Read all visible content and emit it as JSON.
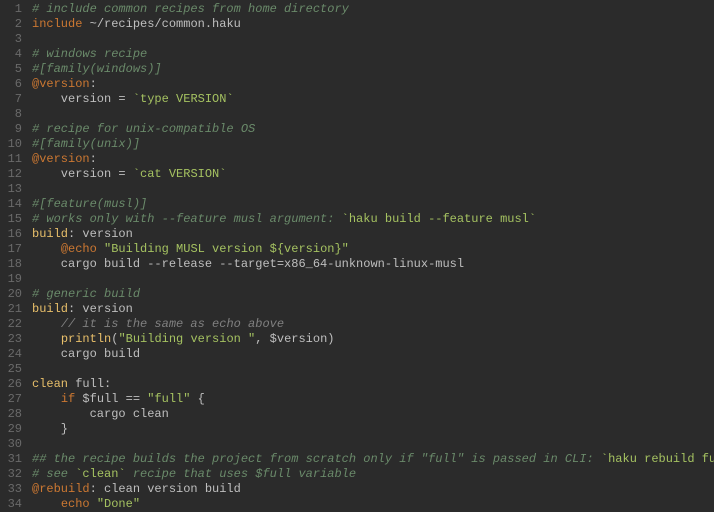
{
  "lines": [
    {
      "n": 1,
      "segs": [
        {
          "cls": "comment",
          "t": "# include common recipes from home directory"
        }
      ]
    },
    {
      "n": 2,
      "segs": [
        {
          "cls": "keyword",
          "t": "include"
        },
        {
          "cls": "plain",
          "t": " ~/recipes/common.haku"
        }
      ]
    },
    {
      "n": 3,
      "segs": []
    },
    {
      "n": 4,
      "segs": [
        {
          "cls": "comment",
          "t": "# windows recipe"
        }
      ]
    },
    {
      "n": 5,
      "segs": [
        {
          "cls": "comment",
          "t": "#[family(windows)]"
        }
      ]
    },
    {
      "n": 6,
      "segs": [
        {
          "cls": "keyword",
          "t": "@version"
        },
        {
          "cls": "plain",
          "t": ":"
        }
      ]
    },
    {
      "n": 7,
      "segs": [
        {
          "cls": "plain",
          "t": "    version = "
        },
        {
          "cls": "backtick",
          "t": "`type VERSION`"
        }
      ]
    },
    {
      "n": 8,
      "segs": []
    },
    {
      "n": 9,
      "segs": [
        {
          "cls": "comment",
          "t": "# recipe for unix-compatible OS"
        }
      ]
    },
    {
      "n": 10,
      "segs": [
        {
          "cls": "comment",
          "t": "#[family(unix)]"
        }
      ]
    },
    {
      "n": 11,
      "segs": [
        {
          "cls": "keyword",
          "t": "@version"
        },
        {
          "cls": "plain",
          "t": ":"
        }
      ]
    },
    {
      "n": 12,
      "segs": [
        {
          "cls": "plain",
          "t": "    version = "
        },
        {
          "cls": "backtick",
          "t": "`cat VERSION`"
        }
      ]
    },
    {
      "n": 13,
      "segs": []
    },
    {
      "n": 14,
      "segs": [
        {
          "cls": "comment",
          "t": "#[feature(musl)]"
        }
      ]
    },
    {
      "n": 15,
      "segs": [
        {
          "cls": "comment",
          "t": "# works only with --feature musl argument: "
        },
        {
          "cls": "backtick",
          "t": "`haku build --feature musl`"
        }
      ]
    },
    {
      "n": 16,
      "segs": [
        {
          "cls": "highlight",
          "t": "build"
        },
        {
          "cls": "plain",
          "t": ": version"
        }
      ]
    },
    {
      "n": 17,
      "segs": [
        {
          "cls": "plain",
          "t": "    "
        },
        {
          "cls": "keyword",
          "t": "@echo"
        },
        {
          "cls": "plain",
          "t": " "
        },
        {
          "cls": "string",
          "t": "\"Building MUSL version ${version}\""
        }
      ]
    },
    {
      "n": 18,
      "segs": [
        {
          "cls": "plain",
          "t": "    cargo build --release --target=x86_64-unknown-linux-musl"
        }
      ]
    },
    {
      "n": 19,
      "segs": []
    },
    {
      "n": 20,
      "segs": [
        {
          "cls": "comment",
          "t": "# generic build"
        }
      ]
    },
    {
      "n": 21,
      "segs": [
        {
          "cls": "highlight",
          "t": "build"
        },
        {
          "cls": "plain",
          "t": ": version"
        }
      ]
    },
    {
      "n": 22,
      "segs": [
        {
          "cls": "plain",
          "t": "    "
        },
        {
          "cls": "comment2",
          "t": "// it is the same as echo above"
        }
      ]
    },
    {
      "n": 23,
      "segs": [
        {
          "cls": "plain",
          "t": "    "
        },
        {
          "cls": "highlight",
          "t": "println"
        },
        {
          "cls": "plain",
          "t": "("
        },
        {
          "cls": "string",
          "t": "\"Building version \""
        },
        {
          "cls": "plain",
          "t": ", $version)"
        }
      ]
    },
    {
      "n": 24,
      "segs": [
        {
          "cls": "plain",
          "t": "    cargo build"
        }
      ]
    },
    {
      "n": 25,
      "segs": []
    },
    {
      "n": 26,
      "segs": [
        {
          "cls": "highlight",
          "t": "clean"
        },
        {
          "cls": "plain",
          "t": " full:"
        }
      ]
    },
    {
      "n": 27,
      "segs": [
        {
          "cls": "plain",
          "t": "    "
        },
        {
          "cls": "keyword",
          "t": "if"
        },
        {
          "cls": "plain",
          "t": " $full == "
        },
        {
          "cls": "string",
          "t": "\"full\""
        },
        {
          "cls": "plain",
          "t": " {"
        }
      ]
    },
    {
      "n": 28,
      "segs": [
        {
          "cls": "plain",
          "t": "        cargo clean"
        }
      ]
    },
    {
      "n": 29,
      "segs": [
        {
          "cls": "plain",
          "t": "    }"
        }
      ]
    },
    {
      "n": 30,
      "segs": []
    },
    {
      "n": 31,
      "segs": [
        {
          "cls": "comment",
          "t": "## the recipe builds the project from scratch only if \"full\" is passed in CLI: "
        },
        {
          "cls": "backtick",
          "t": "`haku rebuild full`"
        }
      ]
    },
    {
      "n": 32,
      "segs": [
        {
          "cls": "comment",
          "t": "# see "
        },
        {
          "cls": "backtick",
          "t": "`clean`"
        },
        {
          "cls": "comment",
          "t": " recipe that uses $full variable"
        }
      ]
    },
    {
      "n": 33,
      "segs": [
        {
          "cls": "keyword",
          "t": "@rebuild"
        },
        {
          "cls": "plain",
          "t": ": clean version build"
        }
      ]
    },
    {
      "n": 34,
      "segs": [
        {
          "cls": "plain",
          "t": "    "
        },
        {
          "cls": "keyword",
          "t": "echo"
        },
        {
          "cls": "plain",
          "t": " "
        },
        {
          "cls": "string",
          "t": "\"Done\""
        }
      ]
    }
  ]
}
